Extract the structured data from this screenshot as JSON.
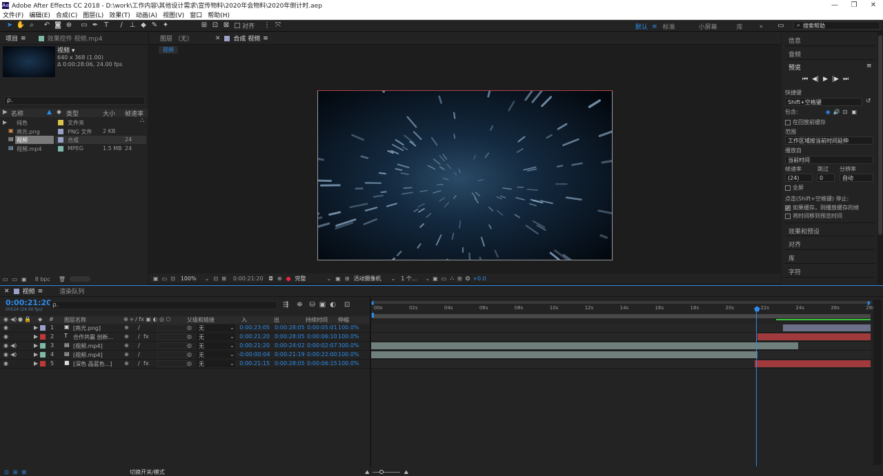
{
  "app": {
    "logo": "Ae",
    "title": "Adobe After Effects CC 2018 - D:\\work\\工作内容\\其他设计需求\\宣传物料\\2020年会物料\\2020年倒计时.aep",
    "window_controls": [
      "—",
      "❐",
      "✕"
    ]
  },
  "menu": [
    "文件(F)",
    "编辑(E)",
    "合成(C)",
    "图层(L)",
    "效果(T)",
    "动画(A)",
    "视图(V)",
    "窗口",
    "帮助(H)"
  ],
  "toolbar": {
    "align_label": "对齐",
    "workspaces": [
      "默认",
      "标准",
      "小屏幕",
      "库"
    ],
    "search_placeholder": "搜索帮助"
  },
  "project": {
    "tab_project": "项目",
    "tab_effects": "效果控件 视频.mp4",
    "item_name": "视频 ▾",
    "item_info_1": "640 x 368 (1.00)",
    "item_info_2": "Δ 0:00:28:06, 24.00 fps",
    "search_icon": "ρ.",
    "columns": [
      "名称",
      "类型",
      "大小",
      "帧速率"
    ],
    "items": [
      {
        "name": "纯色",
        "type": "文件夹",
        "size": "",
        "fps": "",
        "color": "#d8c44a"
      },
      {
        "name": "亮光.png",
        "type": "PNG 文件",
        "size": "2 KB",
        "fps": "",
        "color": "#9aa0c8"
      },
      {
        "name": "视频",
        "type": "合成",
        "size": "",
        "fps": "24",
        "color": "#9aa0c8"
      },
      {
        "name": "视频.mp4",
        "type": "MPEG",
        "size": "1.5 MB",
        "fps": "24",
        "color": "#7fb9a9"
      }
    ],
    "bpc": "8 bpc"
  },
  "comp": {
    "tab_layer": "图层 （无）",
    "tab_comp": "合成 视频",
    "breadcrumb": "视频",
    "zoom": "100%",
    "timecode": "0:00:21:20",
    "quality": "完整",
    "camera": "活动摄像机",
    "views": "1 个...",
    "exposure": "+0.0"
  },
  "timeline": {
    "tab": "视频",
    "tab_render": "渲染队列",
    "timecode": "0:00:21:20",
    "frame_info": "00524 (24.00 fps)",
    "search_icon": "ρ.",
    "columns": [
      "#",
      "图层名称",
      "父级和链接",
      "入",
      "出",
      "持续时间",
      "伸缩"
    ],
    "ruler": [
      "00s",
      "02s",
      "04s",
      "06s",
      "08s",
      "10s",
      "12s",
      "14s",
      "16s",
      "18s",
      "20s",
      "22s",
      "24s",
      "26s",
      "28s"
    ],
    "layers": [
      {
        "num": "1",
        "icon": "▣",
        "name": "[亮光.png]",
        "fx": "",
        "parent": "无",
        "in": "0:00:23:05",
        "out": "0:00:28:05",
        "dur": "0:00:05:01",
        "stretch": "100.0%",
        "color": "#9aa0c8",
        "bar_color": "#6c6f88",
        "bar_start": 0.824,
        "bar_end": 1.0
      },
      {
        "num": "2",
        "icon": "T",
        "name": "合作共赢 创新...",
        "fx": "fx",
        "parent": "无",
        "in": "0:00:21:20",
        "out": "0:00:28:05",
        "dur": "0:00:06:10",
        "stretch": "100.0%",
        "color": "#c03838",
        "bar_color": "#a03a3d",
        "bar_start": 0.774,
        "bar_end": 1.0
      },
      {
        "num": "3",
        "icon": "▤",
        "name": "[视频.mp4]",
        "fx": "",
        "parent": "无",
        "in": "0:00:21:20",
        "out": "0:00:24:02",
        "dur": "0:00:02:07",
        "stretch": "300.0%",
        "color": "#7fb9a9",
        "bar_color": "#6e7f7c",
        "bar_start": 0.0,
        "bar_end": 0.855
      },
      {
        "num": "4",
        "icon": "▤",
        "name": "[视频.mp4]",
        "fx": "",
        "parent": "无",
        "in": "-0:00:00:04",
        "out": "0:00:21:19",
        "dur": "0:00:22:00",
        "stretch": "100.0%",
        "color": "#7fb9a9",
        "bar_color": "#6e7f7c",
        "bar_start": 0.0,
        "bar_end": 0.774
      },
      {
        "num": "5",
        "icon": "■",
        "name": "[深色 品蓝色...]",
        "fx": "fx",
        "parent": "无",
        "in": "0:00:21:15",
        "out": "0:00:28:05",
        "dur": "0:00:06:15",
        "stretch": "100.0%",
        "color": "#c03838",
        "bar_color": "#a03a3d",
        "bar_start": 0.768,
        "bar_end": 1.0
      }
    ],
    "footer": "切换开关/模式"
  },
  "right_panel": {
    "tabs_top": [
      "信息",
      "音频"
    ],
    "preview_title": "预览",
    "shortcut_label": "快捷键",
    "shortcut_value": "Shift+空格键",
    "include_label": "包含:",
    "cache_before": "在回放前缓存",
    "range_label": "范围",
    "range_value": "工作区域按当前时间延伸",
    "play_from_label": "播放自",
    "play_from_value": "当前时间",
    "fps_label": "帧速率",
    "skip_label": "跳过",
    "res_label": "分辨率",
    "fps_value": "(24)",
    "skip_value": "0",
    "res_value": "自动",
    "fullscreen": "全屏",
    "stop_label": "点击(Shift+空格键) 停止:",
    "opt1": "如果缓存，则播放缓存的帧",
    "opt2": "将时间移到预览时间",
    "tabs_bottom": [
      "效果和预设",
      "对齐",
      "库",
      "字符"
    ]
  }
}
